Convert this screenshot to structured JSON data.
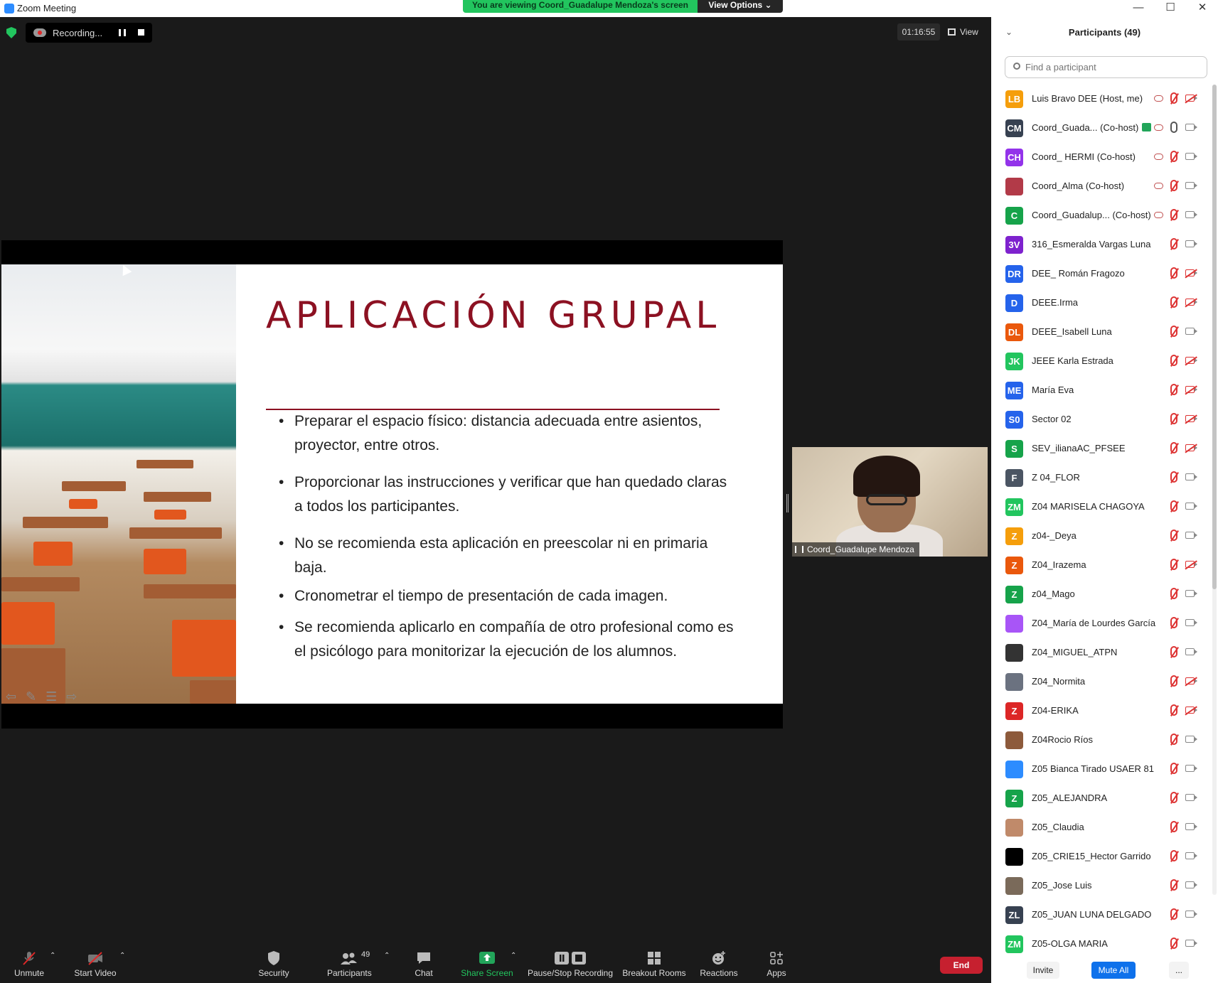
{
  "window": {
    "title": "Zoom Meeting"
  },
  "banner": {
    "viewing": "You are viewing Coord_Guadalupe Mendoza's screen",
    "view_options": "View Options ⌄"
  },
  "top_bar": {
    "recording_label": "Recording...",
    "timer": "01:16:55",
    "view_label": "View"
  },
  "slide": {
    "title": "APLICACIÓN GRUPAL",
    "bullets": [
      "Preparar el espacio físico: distancia adecuada entre asientos, proyector, entre otros.",
      "Proporcionar las instrucciones  y verificar que han quedado claras a todos los participantes.",
      "No se recomienda  esta aplicación en preescolar ni  en primaria baja.",
      "Cronometrar el tiempo de presentación de cada imagen.",
      "Se recomienda aplicarlo en compañía de otro profesional como es el psicólogo para monitorizar la ejecución de los alumnos."
    ]
  },
  "video": {
    "name": "Coord_Guadalupe Mendoza"
  },
  "toolbar": {
    "unmute": "Unmute",
    "start_video": "Start Video",
    "security": "Security",
    "participants": "Participants",
    "participants_count": "49",
    "chat": "Chat",
    "share_screen": "Share Screen",
    "pause_stop": "Pause/Stop Recording",
    "breakout": "Breakout Rooms",
    "reactions": "Reactions",
    "apps": "Apps",
    "end": "End"
  },
  "panel": {
    "title": "Participants (49)",
    "search_placeholder": "Find a participant",
    "participants": [
      {
        "initials": "LB",
        "name": "Luis Bravo DEE (Host, me)",
        "color": "#f59e0b",
        "rec": true,
        "mic": "muted",
        "cam": "off"
      },
      {
        "initials": "CM",
        "name": "Coord_Guada... (Co-host)",
        "color": "#374151",
        "rec": true,
        "mic": "live",
        "cam": "on",
        "sharing": true
      },
      {
        "initials": "CH",
        "name": "Coord_ HERMI (Co-host)",
        "color": "#9333ea",
        "rec": true,
        "mic": "muted",
        "cam": "on"
      },
      {
        "initials": "",
        "name": "Coord_Alma (Co-host)",
        "color": "#b23a48",
        "rec": true,
        "mic": "muted",
        "cam": "on"
      },
      {
        "initials": "C",
        "name": "Coord_Guadalup...  (Co-host)",
        "color": "#16a34a",
        "rec": true,
        "mic": "muted",
        "cam": "on"
      },
      {
        "initials": "3V",
        "name": "316_Esmeralda Vargas Luna",
        "color": "#7e22ce",
        "mic": "muted",
        "cam": "on"
      },
      {
        "initials": "DR",
        "name": "DEE_ Román Fragozo",
        "color": "#2563eb",
        "mic": "muted",
        "cam": "off"
      },
      {
        "initials": "D",
        "name": "DEEE.Irma",
        "color": "#2563eb",
        "mic": "muted",
        "cam": "off"
      },
      {
        "initials": "DL",
        "name": "DEEE_Isabell Luna",
        "color": "#ea580c",
        "mic": "muted",
        "cam": "on"
      },
      {
        "initials": "JK",
        "name": "JEEE Karla Estrada",
        "color": "#22c55e",
        "mic": "muted",
        "cam": "off"
      },
      {
        "initials": "ME",
        "name": "María Eva",
        "color": "#2563eb",
        "mic": "muted",
        "cam": "off"
      },
      {
        "initials": "S0",
        "name": "Sector 02",
        "color": "#2563eb",
        "mic": "muted",
        "cam": "off"
      },
      {
        "initials": "S",
        "name": "SEV_ilianaAC_PFSEE",
        "color": "#16a34a",
        "mic": "muted",
        "cam": "off"
      },
      {
        "initials": "F",
        "name": "Z 04_FLOR",
        "color": "#4b5563",
        "mic": "muted",
        "cam": "on"
      },
      {
        "initials": "ZM",
        "name": "Z04 MARISELA CHAGOYA",
        "color": "#22c55e",
        "mic": "muted",
        "cam": "on"
      },
      {
        "initials": "Z",
        "name": "z04-_Deya",
        "color": "#f59e0b",
        "mic": "muted",
        "cam": "on"
      },
      {
        "initials": "Z",
        "name": "Z04_Irazema",
        "color": "#ea580c",
        "mic": "muted",
        "cam": "off"
      },
      {
        "initials": "Z",
        "name": "z04_Mago",
        "color": "#16a34a",
        "mic": "muted",
        "cam": "on"
      },
      {
        "initials": "",
        "name": "Z04_María de Lourdes García",
        "color": "#a855f7",
        "mic": "muted",
        "cam": "on"
      },
      {
        "initials": "",
        "name": "Z04_MIGUEL_ATPN",
        "color": "#333333",
        "mic": "muted",
        "cam": "on"
      },
      {
        "initials": "",
        "name": "Z04_Normita",
        "color": "#6b7280",
        "mic": "muted",
        "cam": "off"
      },
      {
        "initials": "Z",
        "name": "Z04-ERIKA",
        "color": "#dc2626",
        "mic": "muted",
        "cam": "off"
      },
      {
        "initials": "",
        "name": "Z04Rocio Ríos",
        "color": "#8d5a3b",
        "mic": "muted",
        "cam": "on"
      },
      {
        "initials": "",
        "name": "Z05 Bianca Tirado USAER 81",
        "color": "#2d8cff",
        "mic": "muted",
        "cam": "on"
      },
      {
        "initials": "Z",
        "name": "Z05_ALEJANDRA",
        "color": "#16a34a",
        "mic": "muted",
        "cam": "on"
      },
      {
        "initials": "",
        "name": "Z05_Claudia",
        "color": "#c08a6a",
        "mic": "muted",
        "cam": "on"
      },
      {
        "initials": "",
        "name": "Z05_CRIE15_Hector Garrido",
        "color": "#000000",
        "mic": "muted",
        "cam": "on"
      },
      {
        "initials": "",
        "name": "Z05_Jose Luis",
        "color": "#7a6a5a",
        "mic": "muted",
        "cam": "on"
      },
      {
        "initials": "ZL",
        "name": "Z05_JUAN LUNA DELGADO",
        "color": "#374151",
        "mic": "muted",
        "cam": "on"
      },
      {
        "initials": "ZM",
        "name": "Z05-OLGA MARIA",
        "color": "#22c55e",
        "mic": "muted",
        "cam": "on"
      }
    ],
    "footer": {
      "invite": "Invite",
      "mute_all": "Mute All",
      "more": "..."
    }
  }
}
